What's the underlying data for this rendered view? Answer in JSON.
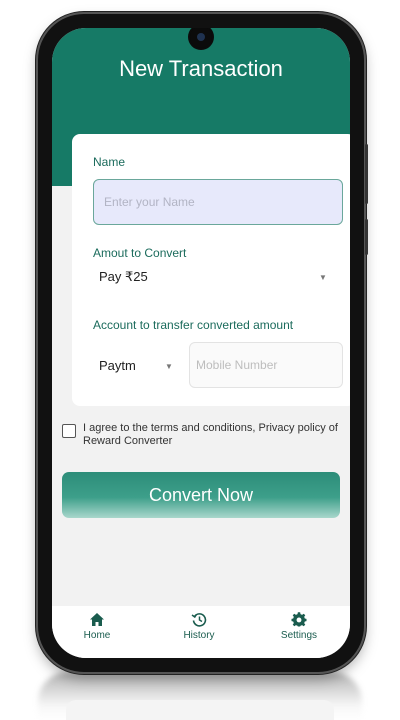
{
  "header": {
    "title": "New Transaction"
  },
  "form": {
    "name_label": "Name",
    "name_placeholder": "Enter your Name",
    "amount_label": "Amout to Convert",
    "amount_selected": "Pay ₹25",
    "account_label": "Account to transfer converted amount",
    "account_selected": "Paytm",
    "mobile_placeholder": "Mobile Number"
  },
  "terms": {
    "text": "I agree to the terms and conditions, Privacy policy of Reward Converter",
    "checked": false
  },
  "convert_button": {
    "label": "Convert Now"
  },
  "bottom_nav": {
    "items": [
      {
        "label": "Home",
        "icon": "home-icon",
        "active": true
      },
      {
        "label": "History",
        "icon": "history-icon",
        "active": false
      },
      {
        "label": "Settings",
        "icon": "gear-icon",
        "active": false
      }
    ]
  },
  "colors": {
    "primary": "#167a66",
    "label": "#1b6b5c",
    "input_fill": "#e7e9fb",
    "background": "#f2f2f2"
  }
}
